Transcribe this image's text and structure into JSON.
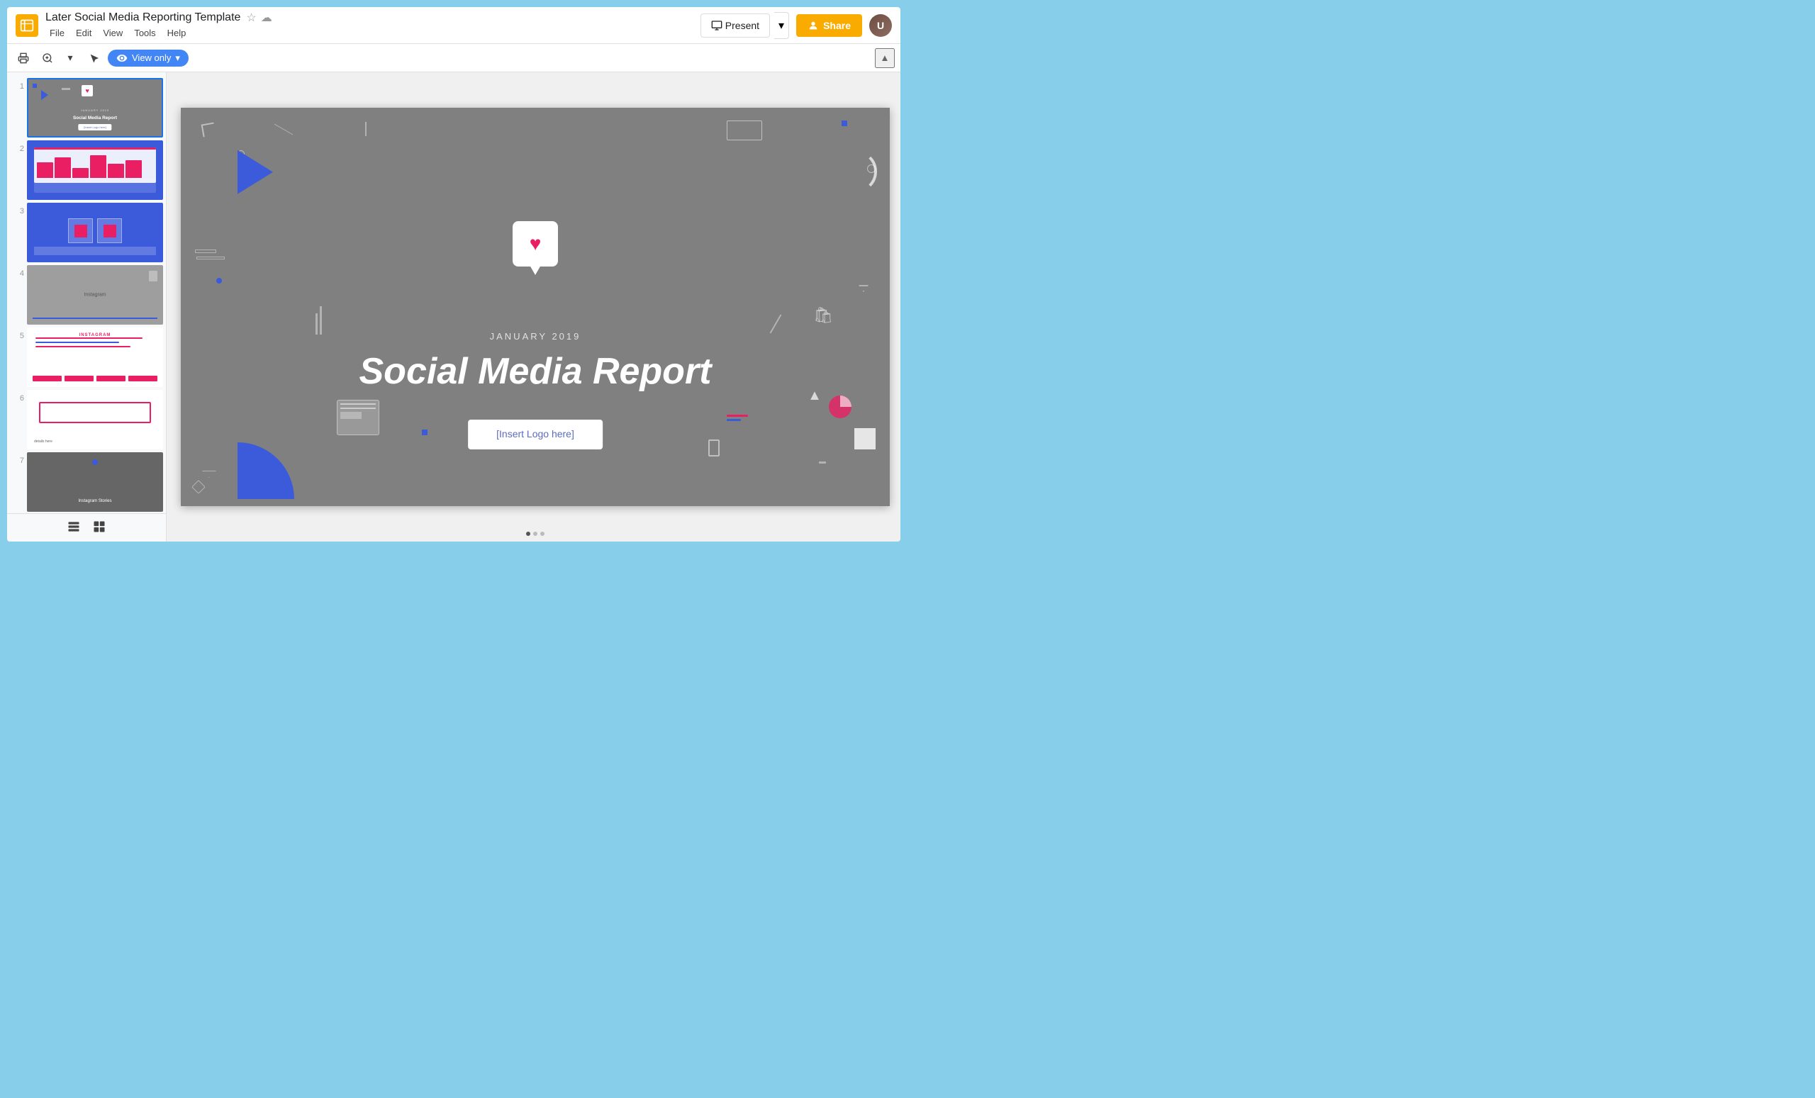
{
  "app": {
    "title": "Later Social Media Reporting Template",
    "icon_color": "#F9AB00"
  },
  "menu": {
    "items": [
      "File",
      "Edit",
      "View",
      "Tools",
      "Help"
    ]
  },
  "header": {
    "present_label": "Present",
    "share_label": "Share",
    "collapse_icon": "▲"
  },
  "toolbar": {
    "view_only_label": "View only",
    "print_icon": "🖨",
    "zoom_icon": "⊕",
    "cursor_icon": "↖"
  },
  "slides": [
    {
      "number": "1",
      "active": true,
      "theme": "gray",
      "title": "Social Media Report",
      "sub": "JANUARY 2019"
    },
    {
      "number": "2",
      "active": false,
      "theme": "blue-chart",
      "title": ""
    },
    {
      "number": "3",
      "active": false,
      "theme": "blue-boxes",
      "title": ""
    },
    {
      "number": "4",
      "active": false,
      "theme": "gray-insta",
      "title": "Instagram"
    },
    {
      "number": "5",
      "active": false,
      "theme": "white-lines",
      "title": "INSTAGRAM"
    },
    {
      "number": "6",
      "active": false,
      "theme": "white-pinkbox",
      "title": ""
    },
    {
      "number": "7",
      "active": false,
      "theme": "gray-stories",
      "title": "Instagram Stories"
    }
  ],
  "main_slide": {
    "date": "JANUARY 2019",
    "title": "Social Media Report",
    "logo_placeholder": "[Insert Logo here]",
    "background_color": "#808080"
  },
  "right_sidebar": {
    "icons": [
      "calendar",
      "star",
      "check-circle"
    ]
  },
  "bottom_nav": {
    "dots": 3
  },
  "slide_views": {
    "list_view_label": "☰",
    "grid_view_label": "⊞"
  }
}
